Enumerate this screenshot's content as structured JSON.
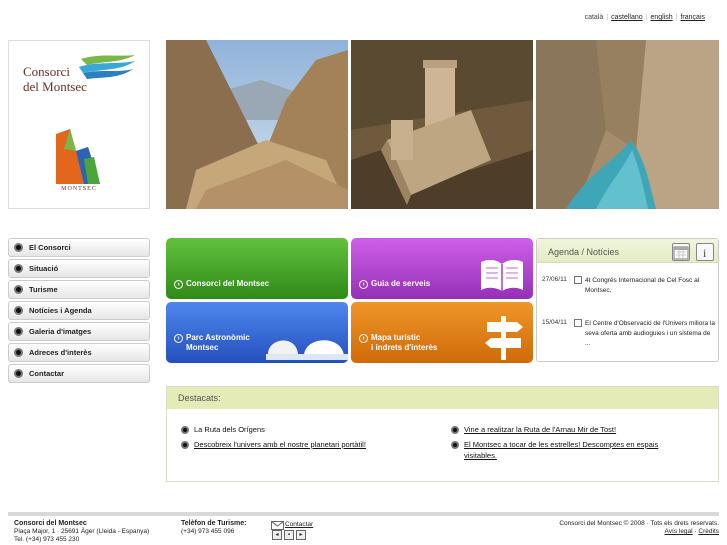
{
  "languages": [
    {
      "label": "català",
      "current": true
    },
    {
      "label": "castellano",
      "current": false
    },
    {
      "label": "english",
      "current": false
    },
    {
      "label": "français",
      "current": false
    }
  ],
  "logo": {
    "line1": "Consorci",
    "line2": "del Montsec",
    "sub": "MONTSEC"
  },
  "nav": [
    "El Consorci",
    "Situació",
    "Turisme",
    "Notícies i Agenda",
    "Galeria d'imatges",
    "Adreces d'interès",
    "Contactar"
  ],
  "tiles": {
    "consorci": "Consorci del Montsec",
    "guia": "Guia de serveis",
    "parc_line1": "Parc Astronòmic",
    "parc_line2": "Montsec",
    "mapa_line1": "Mapa turístic",
    "mapa_line2": "i indrets d'interès"
  },
  "agenda": {
    "title": "Agenda / Notícies",
    "items": [
      {
        "date": "27/06/11",
        "text": "4t Congrés Internacional de Cel Fosc al Montsec."
      },
      {
        "date": "15/04/11",
        "text": "El Centre d'Observació de l'Univers millora la seva oferta amb audioguies i un sistema de ..."
      }
    ]
  },
  "destacats": {
    "title": "Destacats:",
    "left": [
      {
        "text": "La Ruta dels Orígens",
        "link": false
      },
      {
        "text": "Descobreix l'univers amb el nostre planetari portàtil!",
        "link": true
      }
    ],
    "right": [
      {
        "text": "Vine a realitzar la Ruta de l'Arnau Mir de Tost!",
        "link": true
      },
      {
        "text": "El Montsec a tocar de les estrelles! Descomptes en espais visitables.",
        "link": true
      }
    ]
  },
  "footer": {
    "org": "Consorci del Montsec",
    "address": "Plaça Major, 1 · 25691 Àger (Lleida - Espanya)",
    "tel": "Tel. (+34) 973 455 230",
    "tourism_label": "Telèfon de Turisme:",
    "tourism_phone": "(+34) 973 455 096",
    "contact": "Contactar",
    "copyright": "Consorci del Montsec © 2008 · Tots els drets reservats.",
    "legal": "Avís legal",
    "credits": "Crèdits"
  },
  "colors": {
    "green_tile": "#3f9a24",
    "purple_tile": "#a93fc8",
    "blue_tile": "#2f5fd0",
    "orange_tile": "#e0790e",
    "accent_bg": "#e4ebb7"
  }
}
